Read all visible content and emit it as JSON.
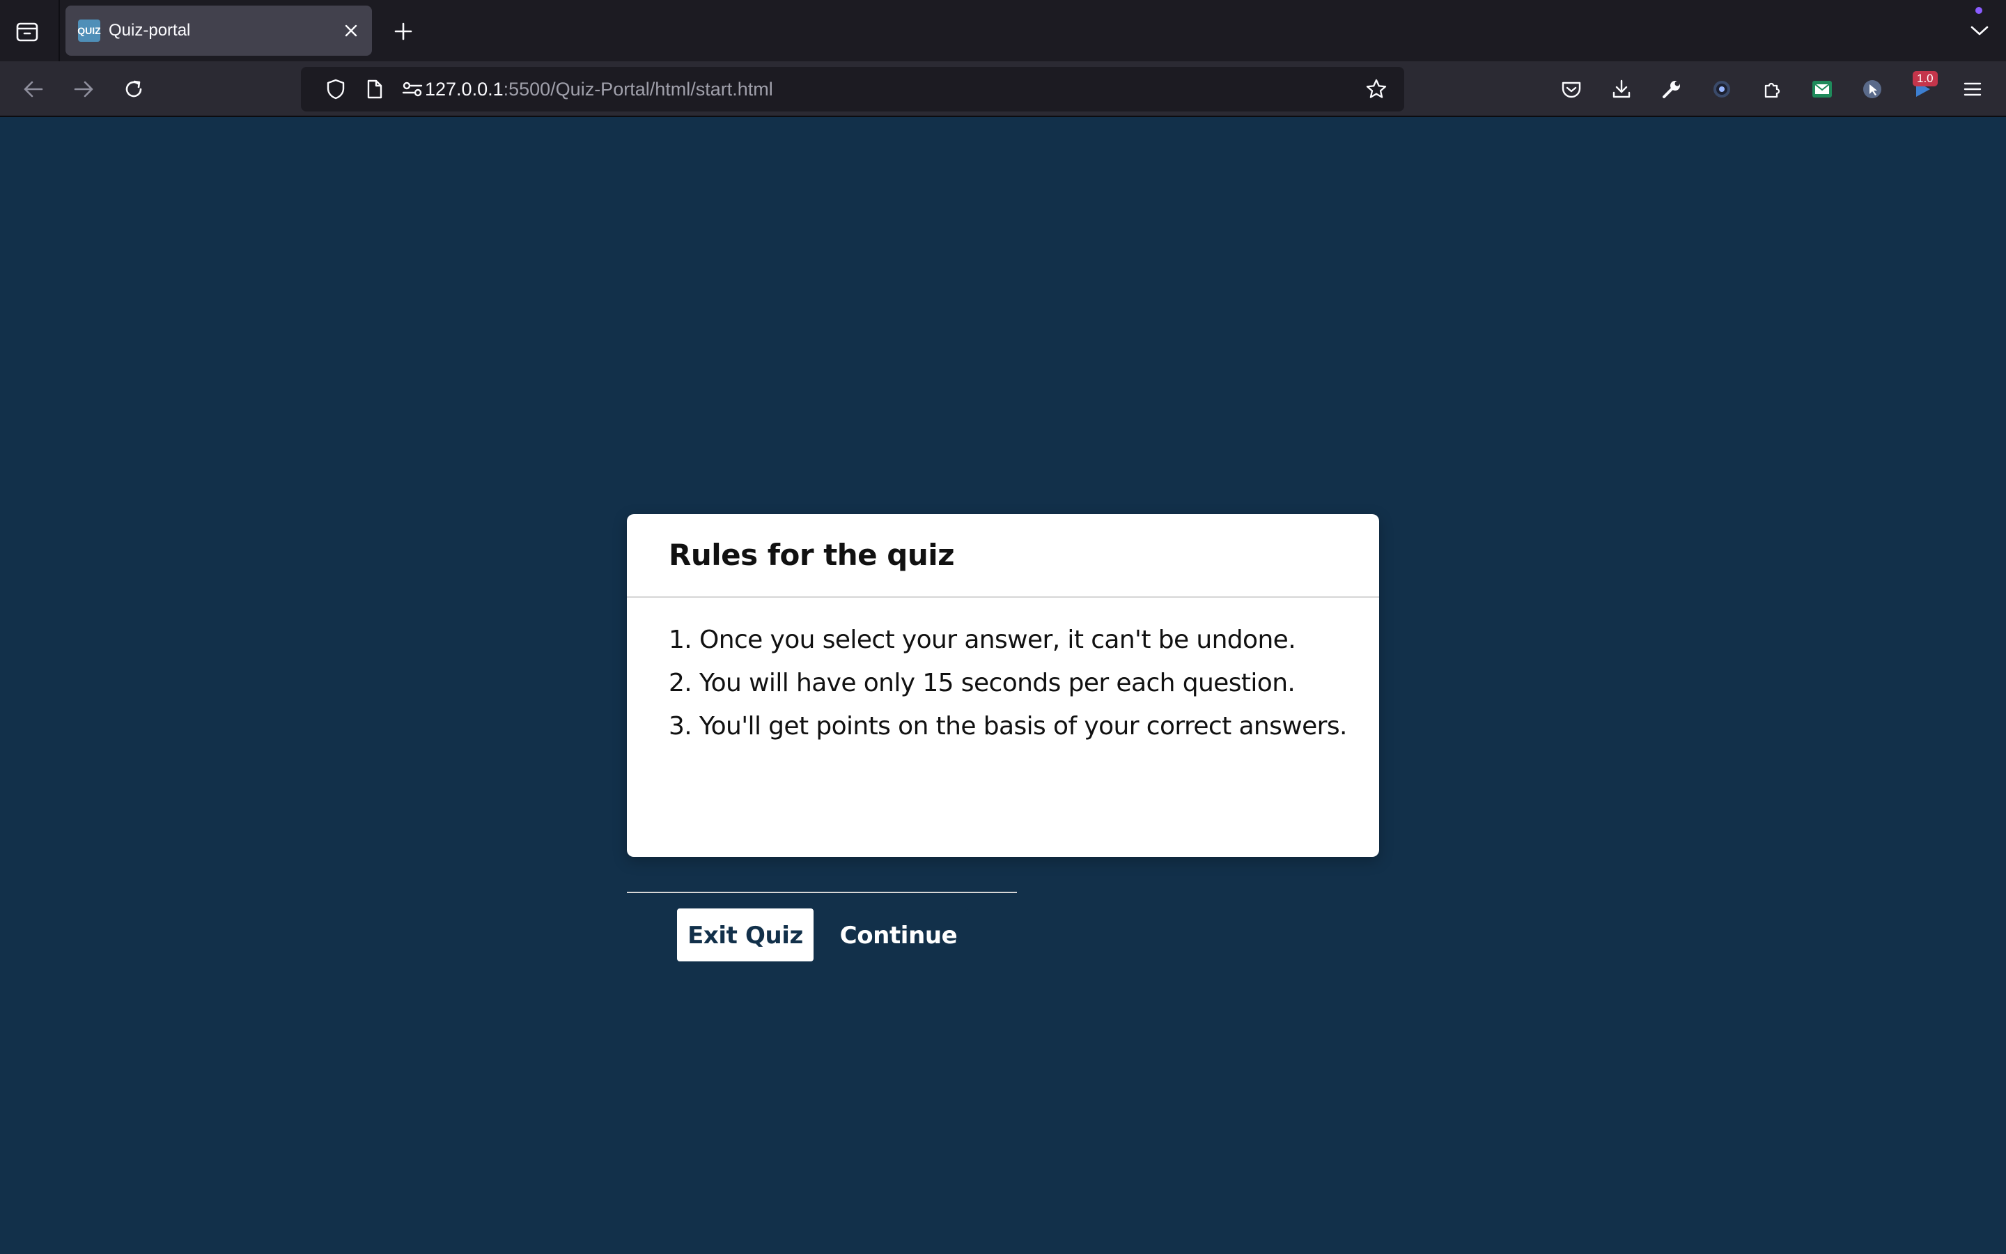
{
  "browser": {
    "tab": {
      "title": "Quiz-portal",
      "favicon_text": "QUIZ"
    },
    "url": {
      "host": "127.0.0.1",
      "path": ":5500/Quiz-Portal/html/start.html"
    },
    "extension_badge": "1.0",
    "colors": {
      "tabbar": "#1c1b22",
      "navbar": "#2b2a33",
      "active_tab": "#42414d"
    }
  },
  "modal": {
    "title": "Rules for the quiz",
    "rules": [
      "1. Once you select your answer, it can't be undone.",
      "2. You will have only 15 seconds per each question.",
      "3. You'll get points on the basis of your correct answers."
    ],
    "buttons": {
      "exit": "Exit Quiz",
      "continue": "Continue"
    }
  },
  "colors": {
    "page_background": "#12304a",
    "modal_background": "#ffffff",
    "primary": "#12304a"
  }
}
